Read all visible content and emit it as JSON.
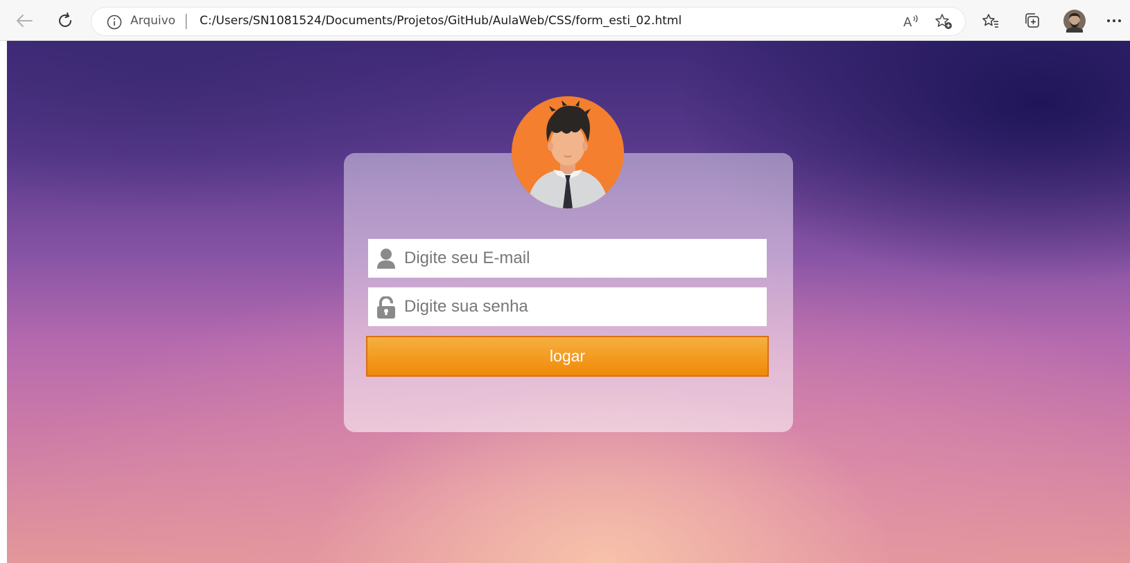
{
  "browser": {
    "address_scheme_label": "Arquivo",
    "url": "C:/Users/SN1081524/Documents/Projetos/GitHub/AulaWeb/CSS/form_esti_02.html",
    "icons": [
      "back-arrow-icon",
      "refresh-icon",
      "info-icon",
      "read-aloud-icon",
      "add-favorite-icon",
      "favorites-icon",
      "collections-icon",
      "profile-avatar-icon",
      "more-options-icon"
    ]
  },
  "login_form": {
    "email_placeholder": "Digite seu E-mail",
    "password_placeholder": "Digite sua senha",
    "submit_label": "logar",
    "accent_color": "#f39a20",
    "avatar_background": "#f37f2f"
  }
}
